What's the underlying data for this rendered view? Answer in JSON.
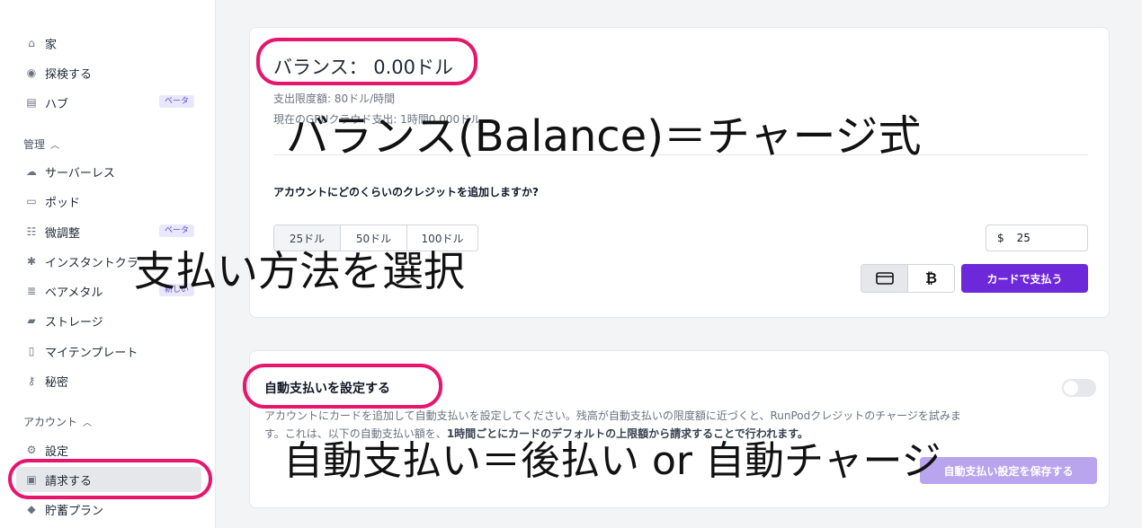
{
  "sidebar": {
    "items": [
      {
        "label": "家",
        "icon": "home-icon",
        "glyph": "⌂"
      },
      {
        "label": "探検する",
        "icon": "compass-icon",
        "glyph": "◉"
      },
      {
        "label": "ハブ",
        "icon": "store-icon",
        "glyph": "▤",
        "badge": "ベータ"
      }
    ],
    "manage": {
      "label": "管理",
      "items": [
        {
          "label": "サーバーレス",
          "icon": "cloud-icon",
          "glyph": "☁"
        },
        {
          "label": "ポッド",
          "icon": "monitor-icon",
          "glyph": "▭"
        },
        {
          "label": "微調整",
          "icon": "sliders-icon",
          "glyph": "☷",
          "badge": "ベータ"
        },
        {
          "label": "インスタントクラ",
          "icon": "cluster-icon",
          "glyph": "✱"
        },
        {
          "label": "ベアメタル",
          "icon": "server-icon",
          "glyph": "≣",
          "badge": "新しい"
        },
        {
          "label": "ストレージ",
          "icon": "folder-icon",
          "glyph": "▰"
        },
        {
          "label": "マイテンプレート",
          "icon": "template-icon",
          "glyph": "▯"
        },
        {
          "label": "秘密",
          "icon": "key-icon",
          "glyph": "⚷"
        }
      ]
    },
    "account": {
      "label": "アカウント",
      "items": [
        {
          "label": "設定",
          "icon": "gear-icon",
          "glyph": "⚙"
        },
        {
          "label": "請求する",
          "icon": "billing-icon",
          "glyph": "▣"
        },
        {
          "label": "貯蓄プラン",
          "icon": "tag-icon",
          "glyph": "◆"
        }
      ]
    }
  },
  "balance": {
    "title": "バランス： 0.00ドル",
    "limit": "支出限度額: 80ドル/時間",
    "current": "現在のGPUクラウド支出: 1時間0.000ドル",
    "question": "アカウントにどのくらいのクレジットを追加しますか?",
    "amounts": [
      "25ドル",
      "50ドル",
      "100ドル"
    ],
    "currency": "$",
    "amount_value": "25",
    "pay_button": "カードで支払う",
    "card_icon": "credit-card-icon",
    "crypto_icon": "bitcoin-icon"
  },
  "autopay": {
    "title": "自動支払いを設定する",
    "desc_line1": "アカウントにカードを追加して自動支払いを設定してください。残高が自動支払いの限度額に近づくと、RunPodクレジットのチャージを試みま",
    "desc_line2_a": "す。これは、以下の自動支払い額を、",
    "desc_line2_b": "1時間ごとにカードのデフォルトの上限額から請求することで行われます。",
    "save_button": "自動支払い設定を保存する"
  },
  "annotations": {
    "balance_note": "バランス(Balance)＝チャージ式",
    "payment_note": "支払い方法を選択",
    "autopay_note": "自動支払い＝後払い or 自動チャージ"
  },
  "colors": {
    "accent": "#6d28d9",
    "highlight": "#e8156d"
  }
}
